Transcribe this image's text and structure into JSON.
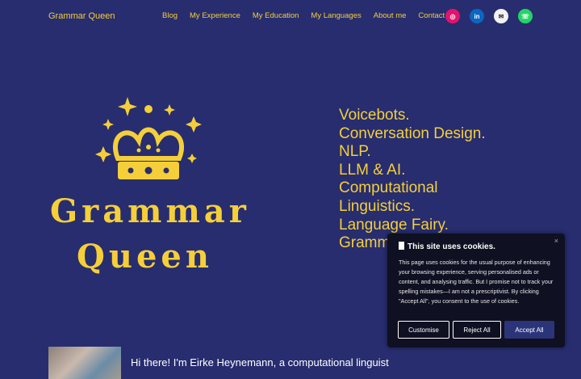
{
  "site": {
    "brand": "Grammar Queen"
  },
  "nav": {
    "items": [
      {
        "label": "Blog"
      },
      {
        "label": "My Experience"
      },
      {
        "label": "My Education"
      },
      {
        "label": "My Languages"
      },
      {
        "label": "About me"
      },
      {
        "label": "Contact"
      }
    ],
    "social": [
      {
        "name": "instagram-icon",
        "glyph": "◎"
      },
      {
        "name": "linkedin-icon",
        "glyph": "in"
      },
      {
        "name": "mail-icon",
        "glyph": "✉"
      },
      {
        "name": "whatsapp-icon",
        "glyph": "☏"
      }
    ]
  },
  "hero": {
    "logo_line1": "Grammar",
    "logo_line2": "Queen",
    "taglines": [
      "Voicebots.",
      "Conversation Design.",
      "NLP.",
      "LLM & AI.",
      "Computational",
      "Linguistics.",
      "Language Fairy.",
      "Grammar Queen."
    ]
  },
  "intro": {
    "text": "Hi there! I'm Eirke Heynemann, a computational linguist"
  },
  "cookie": {
    "title": "This site uses cookies.",
    "close": "×",
    "body": "This page uses cookies for the usual purpose of enhancing your browsing experience, serving personalised ads or content, and analysing traffic. But I promise not to track your spelling mistakes—I am not a prescriptivist. By clicking \"Accept All\", you consent to the use of cookies.",
    "customise": "Customise",
    "reject": "Reject All",
    "accept": "Accept All"
  },
  "colors": {
    "background": "#272d6f",
    "accent": "#f5cf3a",
    "popup": "#0f1021"
  }
}
